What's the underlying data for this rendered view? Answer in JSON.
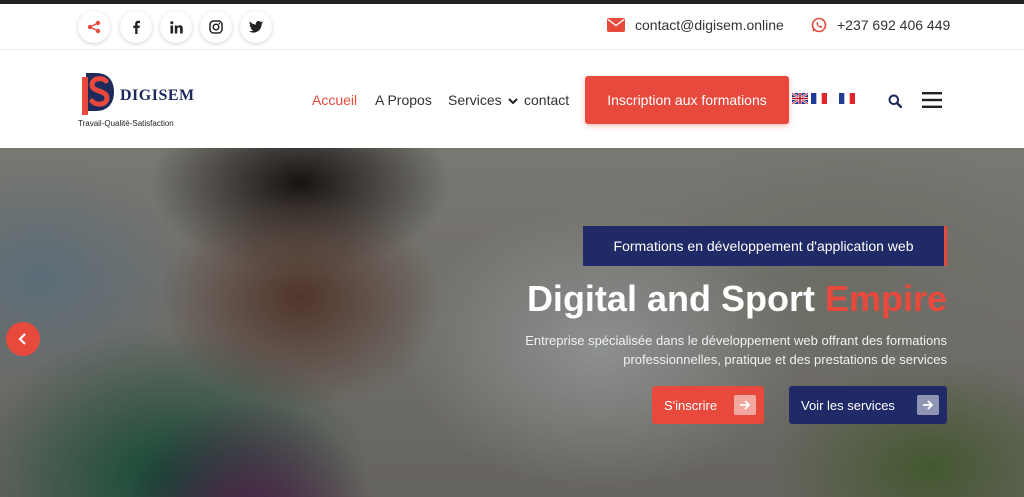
{
  "topbar": {
    "email": "contact@digisem.online",
    "phone": "+237 692 406 449",
    "social_icons": [
      "share-icon",
      "facebook-icon",
      "linkedin-icon",
      "instagram-icon",
      "twitter-icon"
    ]
  },
  "logo": {
    "name": "DIGISEM",
    "tagline": "Travail-Qualité-Satisfaction"
  },
  "nav": {
    "items": [
      "Accueil",
      "A Propos",
      "Services",
      "contact"
    ],
    "active": "Accueil",
    "cta": "Inscription aux formations",
    "flags": [
      "gb-flag-icon",
      "fr-flag-icon",
      "fr-flag-icon"
    ]
  },
  "hero": {
    "badge": "Formations en développement d'application web",
    "title_main": "Digital and Sport ",
    "title_accent": "Empire",
    "desc_line1": "Entreprise spécialisée dans le développement web offrant des formations",
    "desc_line2": "professionnelles, pratique et des prestations de services",
    "btn_primary": "S'inscrire",
    "btn_secondary": "Voir les services"
  },
  "colors": {
    "accent": "#e8493d",
    "navy": "#1f2a66"
  }
}
